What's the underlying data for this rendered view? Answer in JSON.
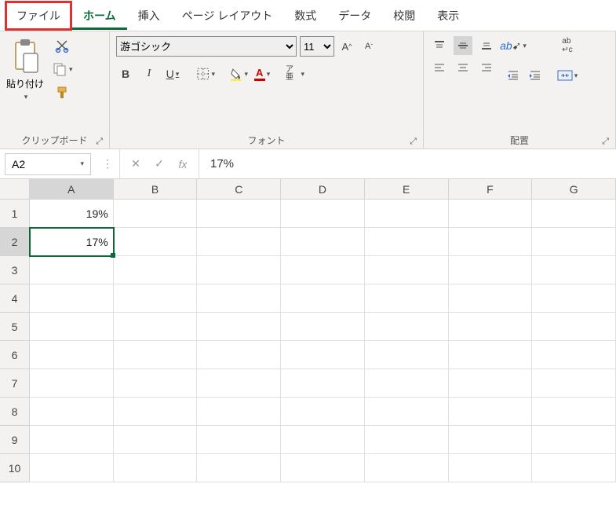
{
  "tabs": {
    "file": "ファイル",
    "home": "ホーム",
    "insert": "挿入",
    "page_layout": "ページ レイアウト",
    "formulas": "数式",
    "data": "データ",
    "review": "校閲",
    "view": "表示"
  },
  "groups": {
    "clipboard": {
      "label": "クリップボード",
      "paste_label": "貼り付け"
    },
    "font": {
      "label": "フォント",
      "font_name": "游ゴシック",
      "font_size": "11",
      "bold": "B",
      "italic": "I",
      "underline": "U",
      "ruby": "ア亜"
    },
    "alignment": {
      "label": "配置",
      "wrap": "ab"
    }
  },
  "namebox": "A2",
  "formula_value": "17%",
  "columns": [
    "A",
    "B",
    "C",
    "D",
    "E",
    "F",
    "G"
  ],
  "rows": [
    "1",
    "2",
    "3",
    "4",
    "5",
    "6",
    "7",
    "8",
    "9",
    "10"
  ],
  "cells": {
    "A1": "19%",
    "A2": "17%"
  },
  "active_cell": "A2",
  "chart_data": {
    "type": "table",
    "columns": [
      "A"
    ],
    "rows": [
      {
        "row": 1,
        "A": "19%"
      },
      {
        "row": 2,
        "A": "17%"
      }
    ]
  }
}
